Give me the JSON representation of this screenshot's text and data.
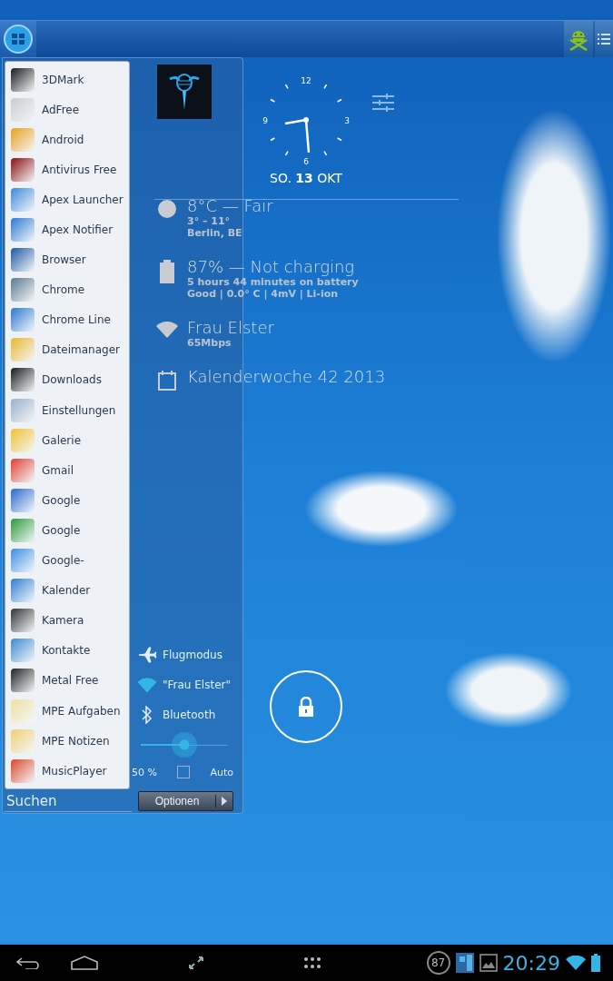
{
  "apps": [
    {
      "name": "3DMark"
    },
    {
      "name": "AdFree"
    },
    {
      "name": "Android"
    },
    {
      "name": "Antivirus Free"
    },
    {
      "name": "Apex Launcher"
    },
    {
      "name": "Apex Notifier"
    },
    {
      "name": "Browser"
    },
    {
      "name": "Chrome"
    },
    {
      "name": "Chrome Line"
    },
    {
      "name": "Dateimanager"
    },
    {
      "name": "Downloads"
    },
    {
      "name": "Einstellungen"
    },
    {
      "name": "Galerie"
    },
    {
      "name": "Gmail"
    },
    {
      "name": "Google"
    },
    {
      "name": "Google"
    },
    {
      "name": "Google-"
    },
    {
      "name": "Kalender"
    },
    {
      "name": "Kamera"
    },
    {
      "name": "Kontakte"
    },
    {
      "name": "Metal Free"
    },
    {
      "name": "MPE Aufgaben"
    },
    {
      "name": "MPE Notizen"
    },
    {
      "name": "MusicPlayer"
    }
  ],
  "toggles": [
    {
      "kind": "airplane",
      "label": "Flugmodus",
      "on": false
    },
    {
      "kind": "wifi",
      "label": "\"Frau Elster\"",
      "on": true
    },
    {
      "kind": "bluetooth",
      "label": "Bluetooth",
      "on": false
    }
  ],
  "brightness": {
    "level": 0.5,
    "reading": "50 %",
    "auto_label": "Auto",
    "auto_checked": false
  },
  "search": {
    "placeholder": "Suchen"
  },
  "options_button": "Optionen",
  "clock": {
    "numerals": [
      "12",
      "3",
      "6",
      "9"
    ],
    "date": "SO. **13** OKT"
  },
  "info_rows": [
    {
      "kind": "weather",
      "title": "8°C — Fair",
      "lines": [
        "3° – 11°",
        "Berlin, BE"
      ]
    },
    {
      "kind": "battery",
      "title": "87% — Not charging",
      "lines": [
        "5 hours 44 minutes on battery",
        "Good | 0.0° C | 4mV | Li-ion"
      ]
    },
    {
      "kind": "wifi",
      "title": "Frau Elster",
      "lines": [
        "65Mbps"
      ]
    },
    {
      "kind": "calendar",
      "title": "Kalenderwoche 42 2013",
      "lines": []
    }
  ],
  "status_bar": {
    "notification_count": "87",
    "time": "20:29"
  }
}
